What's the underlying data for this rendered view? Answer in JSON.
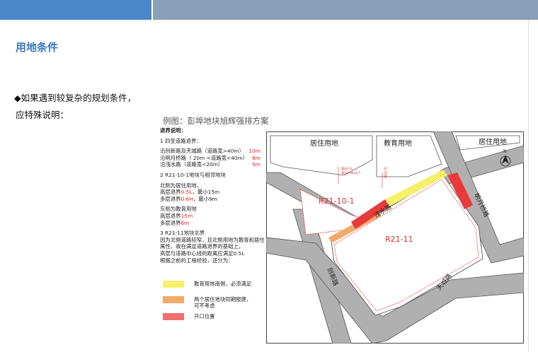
{
  "header": {
    "title": "用地条件"
  },
  "intro": {
    "line1": "◆如果遇到较复杂的规划条件，",
    "line2": "应特殊说明："
  },
  "example_caption": "例图：彭埠地块旭辉强排方案",
  "legend": {
    "heading": "退界说明：",
    "s1_title": "1 四至道路退界：",
    "s1_rows": [
      {
        "label": "沿创新路及天城路（道路宽>40m）",
        "value": "10m"
      },
      {
        "label": "沿明月桥路（ 20m <道路宽<40m）",
        "value": "8m"
      },
      {
        "label": "沿浅水路（道路宽<20m）",
        "value": "5m"
      }
    ],
    "s2_title": "2 R21-10-1地块与相邻地块",
    "s2_a1": "北侧为居住用地，",
    "s2_a2_pre": "高层退界",
    "s2_a2_red": "0.5L",
    "s2_a2_post": "，最小15m",
    "s2_a3_pre": "多层退界",
    "s2_a3_red": "0.6H",
    "s2_a3_post": "，最小9m",
    "s2_b1": "东侧为教育用地",
    "s2_b2_pre": "高层退界",
    "s2_b2_red": "15m",
    "s2_b3_pre": "多层退界",
    "s2_b3_red": "6m",
    "s3_lines": [
      "3 R21-11地块北界",
      "因为北侧道路较窄，且北侧用地为教育和居住",
      "属性，故在满足道路退界的基础上，",
      "高层与道路中心线的距离应满足0.5L",
      "根据之前的工程经验，还分为："
    ],
    "swatches": [
      {
        "color": "#f6f06a",
        "label": "教育用地南侧，必须满足"
      },
      {
        "color": "#f2aa6a",
        "label": "两个居住地块同期报建，",
        "label2": "可不考虑"
      },
      {
        "color": "#f07070",
        "label": "开口位置"
      }
    ]
  },
  "map": {
    "zone_north_left": "居住用地",
    "zone_north_mid": "教育用地",
    "zone_north_right": "居住用地",
    "parcel_a": "R21-10-1",
    "parcel_b": "R21-11",
    "road_qianshui": "浅水路",
    "road_mingyueqiao": "明月桥路",
    "road_chuangxin": "创新路",
    "road_tiancheng": "天城路",
    "north_label": "N",
    "dim_a": "满足0.5L",
    "dim_b": "满足0.6H≥0.5",
    "dim_c": "满足0.5L"
  },
  "colors": {
    "road": "#a8a8a8",
    "road_edge": "#555555",
    "parcel_outline": "#e03030",
    "yellow": "#f6f06a",
    "orange": "#f2aa6a",
    "red": "#e83a3a"
  }
}
